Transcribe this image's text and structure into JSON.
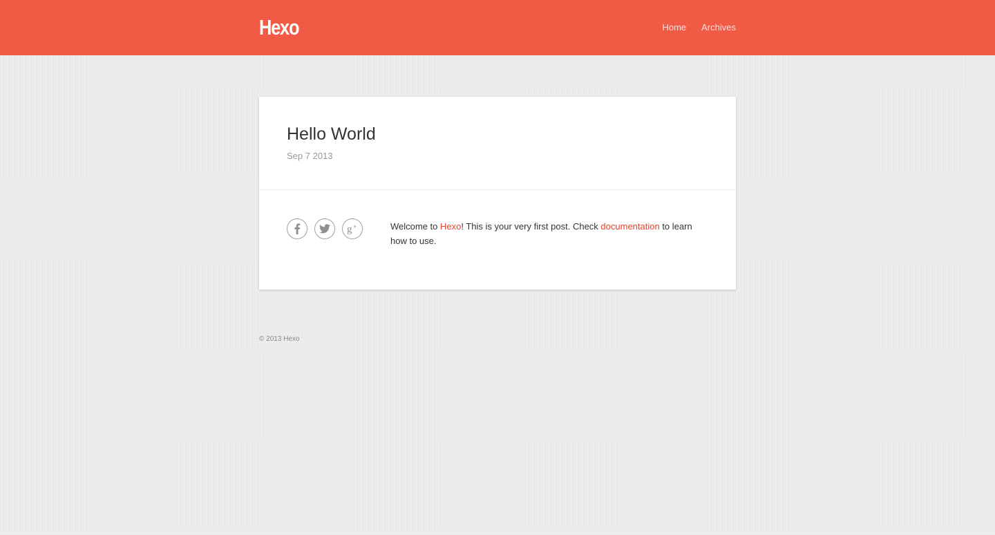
{
  "site": {
    "logo": "Hexo",
    "nav": [
      {
        "label": "Home"
      },
      {
        "label": "Archives"
      }
    ]
  },
  "post": {
    "title": "Hello World",
    "date": "Sep 7 2013",
    "share_icons": [
      "facebook-icon",
      "twitter-icon",
      "google-plus-icon"
    ],
    "content": {
      "text_1": "Welcome to ",
      "link_1": "Hexo",
      "text_2": "! This is your very first post. Check ",
      "link_2": "documentation",
      "text_3": " to learn how to use."
    }
  },
  "footer": {
    "copyright": "© 2013 Hexo"
  },
  "colors": {
    "header_bg": "#f15a45",
    "link": "#e8412d",
    "page_bg": "#eeeeee"
  }
}
